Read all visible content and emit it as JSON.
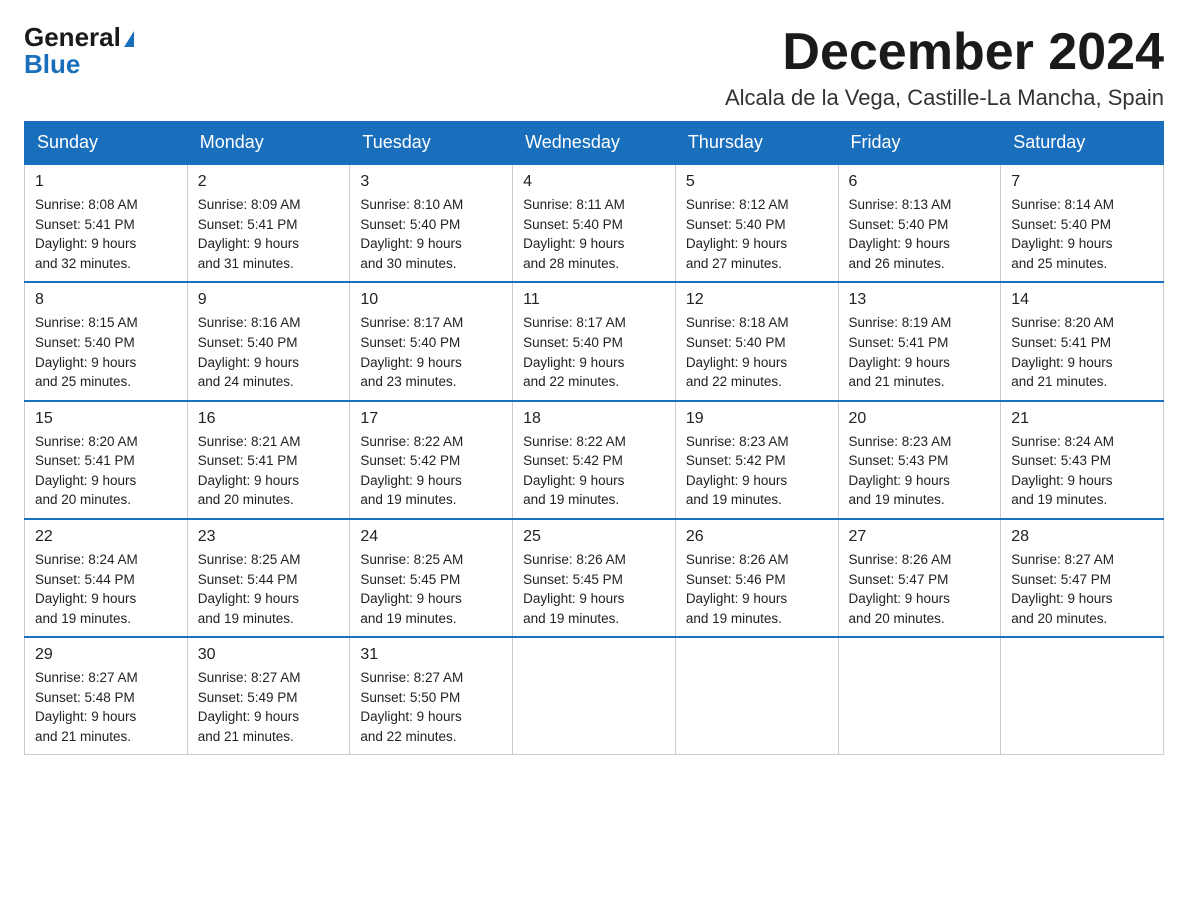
{
  "logo": {
    "general": "General",
    "triangle": "▶",
    "blue": "Blue"
  },
  "header": {
    "month_title": "December 2024",
    "location": "Alcala de la Vega, Castille-La Mancha, Spain"
  },
  "weekdays": [
    "Sunday",
    "Monday",
    "Tuesday",
    "Wednesday",
    "Thursday",
    "Friday",
    "Saturday"
  ],
  "weeks": [
    [
      {
        "day": "1",
        "sunrise": "8:08 AM",
        "sunset": "5:41 PM",
        "daylight": "9 hours and 32 minutes."
      },
      {
        "day": "2",
        "sunrise": "8:09 AM",
        "sunset": "5:41 PM",
        "daylight": "9 hours and 31 minutes."
      },
      {
        "day": "3",
        "sunrise": "8:10 AM",
        "sunset": "5:40 PM",
        "daylight": "9 hours and 30 minutes."
      },
      {
        "day": "4",
        "sunrise": "8:11 AM",
        "sunset": "5:40 PM",
        "daylight": "9 hours and 28 minutes."
      },
      {
        "day": "5",
        "sunrise": "8:12 AM",
        "sunset": "5:40 PM",
        "daylight": "9 hours and 27 minutes."
      },
      {
        "day": "6",
        "sunrise": "8:13 AM",
        "sunset": "5:40 PM",
        "daylight": "9 hours and 26 minutes."
      },
      {
        "day": "7",
        "sunrise": "8:14 AM",
        "sunset": "5:40 PM",
        "daylight": "9 hours and 25 minutes."
      }
    ],
    [
      {
        "day": "8",
        "sunrise": "8:15 AM",
        "sunset": "5:40 PM",
        "daylight": "9 hours and 25 minutes."
      },
      {
        "day": "9",
        "sunrise": "8:16 AM",
        "sunset": "5:40 PM",
        "daylight": "9 hours and 24 minutes."
      },
      {
        "day": "10",
        "sunrise": "8:17 AM",
        "sunset": "5:40 PM",
        "daylight": "9 hours and 23 minutes."
      },
      {
        "day": "11",
        "sunrise": "8:17 AM",
        "sunset": "5:40 PM",
        "daylight": "9 hours and 22 minutes."
      },
      {
        "day": "12",
        "sunrise": "8:18 AM",
        "sunset": "5:40 PM",
        "daylight": "9 hours and 22 minutes."
      },
      {
        "day": "13",
        "sunrise": "8:19 AM",
        "sunset": "5:41 PM",
        "daylight": "9 hours and 21 minutes."
      },
      {
        "day": "14",
        "sunrise": "8:20 AM",
        "sunset": "5:41 PM",
        "daylight": "9 hours and 21 minutes."
      }
    ],
    [
      {
        "day": "15",
        "sunrise": "8:20 AM",
        "sunset": "5:41 PM",
        "daylight": "9 hours and 20 minutes."
      },
      {
        "day": "16",
        "sunrise": "8:21 AM",
        "sunset": "5:41 PM",
        "daylight": "9 hours and 20 minutes."
      },
      {
        "day": "17",
        "sunrise": "8:22 AM",
        "sunset": "5:42 PM",
        "daylight": "9 hours and 19 minutes."
      },
      {
        "day": "18",
        "sunrise": "8:22 AM",
        "sunset": "5:42 PM",
        "daylight": "9 hours and 19 minutes."
      },
      {
        "day": "19",
        "sunrise": "8:23 AM",
        "sunset": "5:42 PM",
        "daylight": "9 hours and 19 minutes."
      },
      {
        "day": "20",
        "sunrise": "8:23 AM",
        "sunset": "5:43 PM",
        "daylight": "9 hours and 19 minutes."
      },
      {
        "day": "21",
        "sunrise": "8:24 AM",
        "sunset": "5:43 PM",
        "daylight": "9 hours and 19 minutes."
      }
    ],
    [
      {
        "day": "22",
        "sunrise": "8:24 AM",
        "sunset": "5:44 PM",
        "daylight": "9 hours and 19 minutes."
      },
      {
        "day": "23",
        "sunrise": "8:25 AM",
        "sunset": "5:44 PM",
        "daylight": "9 hours and 19 minutes."
      },
      {
        "day": "24",
        "sunrise": "8:25 AM",
        "sunset": "5:45 PM",
        "daylight": "9 hours and 19 minutes."
      },
      {
        "day": "25",
        "sunrise": "8:26 AM",
        "sunset": "5:45 PM",
        "daylight": "9 hours and 19 minutes."
      },
      {
        "day": "26",
        "sunrise": "8:26 AM",
        "sunset": "5:46 PM",
        "daylight": "9 hours and 19 minutes."
      },
      {
        "day": "27",
        "sunrise": "8:26 AM",
        "sunset": "5:47 PM",
        "daylight": "9 hours and 20 minutes."
      },
      {
        "day": "28",
        "sunrise": "8:27 AM",
        "sunset": "5:47 PM",
        "daylight": "9 hours and 20 minutes."
      }
    ],
    [
      {
        "day": "29",
        "sunrise": "8:27 AM",
        "sunset": "5:48 PM",
        "daylight": "9 hours and 21 minutes."
      },
      {
        "day": "30",
        "sunrise": "8:27 AM",
        "sunset": "5:49 PM",
        "daylight": "9 hours and 21 minutes."
      },
      {
        "day": "31",
        "sunrise": "8:27 AM",
        "sunset": "5:50 PM",
        "daylight": "9 hours and 22 minutes."
      },
      null,
      null,
      null,
      null
    ]
  ],
  "labels": {
    "sunrise": "Sunrise:",
    "sunset": "Sunset:",
    "daylight": "Daylight:"
  }
}
